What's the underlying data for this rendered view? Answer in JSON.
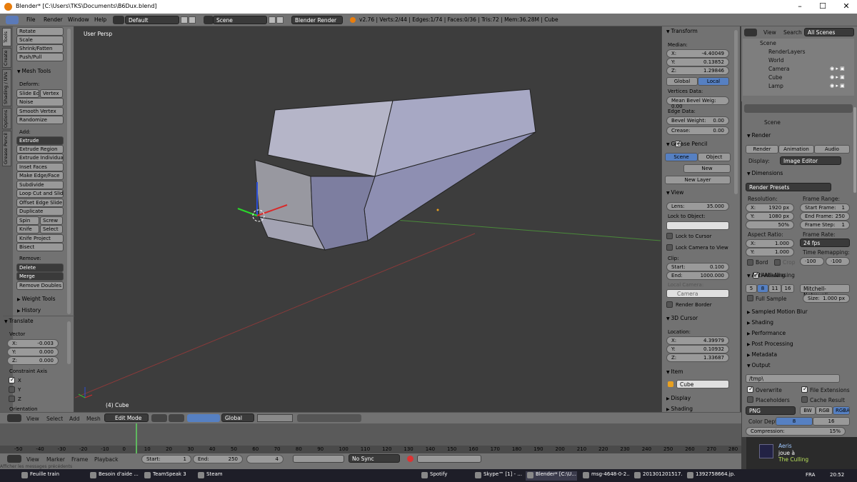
{
  "window": {
    "title": "Blender* [C:\\Users\\TKS\\Documents\\B6Dux.blend]",
    "min": "–",
    "max": "☐",
    "close": "✕"
  },
  "info": {
    "menus": [
      "File",
      "Render",
      "Window",
      "Help"
    ],
    "layout": "Default",
    "scene": "Scene",
    "engine": "Blender Render",
    "stats": "v2.76 | Verts:2/44 | Edges:1/74 | Faces:0/36 | Tris:72 | Mem:36.28M | Cube"
  },
  "tabs": [
    "Tools",
    "Create",
    "Shading / UVs",
    "Options",
    "Grease Pencil"
  ],
  "tools": {
    "top_buttons": [
      "Rotate",
      "Scale",
      "Shrink/Fatten",
      "Push/Pull"
    ],
    "mesh_tools": "Mesh Tools",
    "deform": "Deform:",
    "slide_edge": "Slide Ed",
    "vertex": "Vertex",
    "noise": "Noise",
    "smooth_vertex": "Smooth Vertex",
    "randomize": "Randomize",
    "add": "Add:",
    "extrude": "Extrude",
    "extrude_region": "Extrude Region",
    "extrude_individual": "Extrude Individual",
    "inset_faces": "Inset Faces",
    "make_edge_face": "Make Edge/Face",
    "subdivide": "Subdivide",
    "loop_cut": "Loop Cut and Slide",
    "offset_edge": "Offset Edge Slide",
    "duplicate": "Duplicate",
    "spin": "Spin",
    "screw": "Screw",
    "knife": "Knife",
    "select": "Select",
    "knife_project": "Knife Project",
    "bisect": "Bisect",
    "remove": "Remove:",
    "delete": "Delete",
    "merge": "Merge",
    "remove_doubles": "Remove Doubles",
    "weight_tools": "Weight Tools",
    "history": "History"
  },
  "operator": {
    "title": "Translate",
    "vector": "Vector",
    "x_label": "X:",
    "x": "-0.003",
    "y_label": "Y:",
    "y": "0.000",
    "z_label": "Z:",
    "z": "0.000",
    "constraint_axis": "Constraint Axis",
    "cx": "X",
    "cy": "Y",
    "cz": "Z",
    "orientation": "Orientation"
  },
  "viewport": {
    "label": "User Persp",
    "object": "(4) Cube"
  },
  "npanel": {
    "transform": "Transform",
    "median": "Median:",
    "x_label": "X:",
    "x": "-4.40049",
    "y_label": "Y:",
    "y": "0.13852",
    "z_label": "Z:",
    "z": "1.29846",
    "global": "Global",
    "local": "Local",
    "vertices_data": "Vertices Data:",
    "mean_bevel": "Mean Bevel Weig: 0.00",
    "edge_data": "Edge Data:",
    "bevel_weight_label": "Bevel Weight:",
    "bevel_weight": "0.00",
    "crease_label": "Crease:",
    "crease": "0.00",
    "grease_pencil": "Grease Pencil",
    "scene": "Scene",
    "object": "Object",
    "new": "New",
    "new_layer": "New Layer",
    "view": "View",
    "lens_label": "Lens:",
    "lens": "35.000",
    "lock_to_object": "Lock to Object:",
    "lock_to_cursor": "Lock to Cursor",
    "lock_camera": "Lock Camera to View",
    "clip": "Clip:",
    "start_label": "Start:",
    "start": "0.100",
    "end_label": "End:",
    "end": "1000.000",
    "local_camera": "Local Camera:",
    "camera": "Camera",
    "render_border": "Render Border",
    "cursor": "3D Cursor",
    "location": "Location:",
    "cx_label": "X:",
    "cx": "4.39979",
    "cy_label": "Y:",
    "cy": "0.10932",
    "cz_label": "Z:",
    "cz": "1.33687",
    "item": "Item",
    "item_name": "Cube",
    "display": "Display",
    "shading": "Shading"
  },
  "outliner": {
    "view": "View",
    "search": "Search",
    "all_scenes": "All Scenes",
    "items": [
      "Scene",
      "RenderLayers",
      "World",
      "Camera",
      "Cube",
      "Lamp"
    ]
  },
  "props": {
    "scene": "Scene",
    "render": "Render",
    "render_btn": "Render",
    "animation": "Animation",
    "audio": "Audio",
    "display_label": "Display:",
    "display": "Image Editor",
    "dimensions": "Dimensions",
    "presets": "Render Presets",
    "resolution": "Resolution:",
    "res_x_label": "X:",
    "res_x": "1920 px",
    "res_y_label": "Y:",
    "res_y": "1080 px",
    "res_pct": "50%",
    "frame_range": "Frame Range:",
    "start_frame": "Start Frame:",
    "start_frame_v": "1",
    "end_frame": "End Frame:",
    "end_frame_v": "250",
    "frame_step": "Frame Step:",
    "frame_step_v": "1",
    "aspect": "Aspect Ratio:",
    "asp_x_label": "X:",
    "asp_x": "1.000",
    "asp_y_label": "Y:",
    "asp_y": "1.000",
    "frame_rate": "Frame Rate:",
    "fps": "24 fps",
    "time_remap": "Time Remapping:",
    "remap_old": "·100",
    "remap_new": "·100",
    "bord": "Bord",
    "crop": "Crop",
    "anti_aliasing": "Anti-Aliasing",
    "aa": [
      "5",
      "8",
      "11",
      "16"
    ],
    "filter": "Mitchell-Netravali",
    "full_sample": "Full Sample",
    "size_label": "Size:",
    "size": "1.000 px",
    "motion_blur": "Sampled Motion Blur",
    "shading": "Shading",
    "performance": "Performance",
    "post_processing": "Post Processing",
    "metadata": "Metadata",
    "output": "Output",
    "path": "/tmp\\",
    "overwrite": "Overwrite",
    "file_ext": "File Extensions",
    "placeholders": "Placeholders",
    "cache_result": "Cache Result",
    "format": "PNG",
    "bw": "BW",
    "rgb": "RGB",
    "rgba": "RGBA",
    "color_depth": "Color Depth:",
    "depth8": "8",
    "depth16": "16",
    "compression": "Compression:",
    "compression_v": "15%"
  },
  "vphdr": {
    "view": "View",
    "select": "Select",
    "add": "Add",
    "mesh": "Mesh",
    "mode": "Edit Mode",
    "orientation": "Global"
  },
  "timeline": {
    "ticks": [
      "-50",
      "-40",
      "-30",
      "-20",
      "-10",
      "0",
      "10",
      "20",
      "30",
      "40",
      "50",
      "60",
      "70",
      "80",
      "90",
      "100",
      "110",
      "120",
      "130",
      "140",
      "150",
      "160",
      "170",
      "180",
      "190",
      "200",
      "210",
      "220",
      "230",
      "240",
      "250",
      "260",
      "270",
      "280"
    ],
    "view": "View",
    "marker": "Marker",
    "frame": "Frame",
    "playback": "Playback",
    "start_label": "Start:",
    "start": "1",
    "end_label": "End:",
    "end": "250",
    "current": "4",
    "sync": "No Sync"
  },
  "status": "Afficher les messages précédents",
  "notification": {
    "name": "Aeris",
    "line1": "joue à",
    "line2": "The Culling"
  },
  "taskbar": {
    "items": [
      "Feuille train",
      "Besoin d'aide ...",
      "TeamSpeak 3",
      "Steam",
      "",
      "",
      "",
      "",
      "",
      "",
      "",
      "Spotify",
      "Skype™ [1] - ...",
      "Blender* [C:\\U...",
      "msg-4648-0-2...",
      "201301201517...",
      "1392758664.jp..."
    ],
    "lang": "FRA",
    "time": "20:52"
  }
}
